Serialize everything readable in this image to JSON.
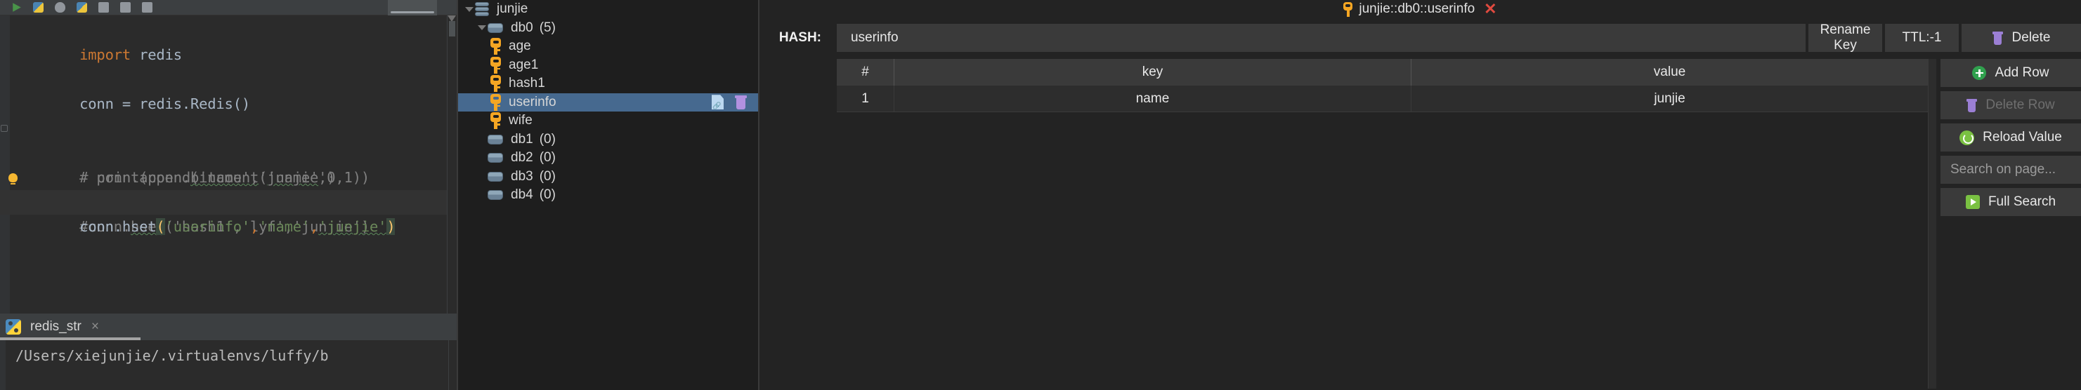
{
  "ide": {
    "toolbar_icons": [
      "run-icon",
      "python-config-icon",
      "debug-icon",
      "python-file-icon",
      "coverage-icon",
      "profile-icon",
      "stop-icon",
      "selected-tab"
    ],
    "code_lines": [
      {
        "id": "l1",
        "segments": [
          {
            "t": "import ",
            "c": "kw"
          },
          {
            "t": "redis",
            "c": "txt"
          }
        ]
      },
      {
        "id": "l2",
        "segments": []
      },
      {
        "id": "l3",
        "segments": [
          {
            "t": "conn = redis.Redis()",
            "c": "txt"
          }
        ]
      },
      {
        "id": "l4",
        "segments": []
      },
      {
        "id": "l5",
        "gutter": "fold",
        "segments": [
          {
            "t": "# print(conn.",
            "c": "cmt"
          },
          {
            "t": "bitcount",
            "c": "cmt squig"
          },
          {
            "t": "('name',0,1))",
            "c": "cmt"
          }
        ]
      },
      {
        "id": "l6",
        "segments": [
          {
            "t": "# conn.append('name','",
            "c": "cmt"
          },
          {
            "t": "junjie",
            "c": "cmt squig"
          },
          {
            "t": "')",
            "c": "cmt"
          }
        ]
      },
      {
        "id": "l7",
        "gutter": "bulb",
        "segments": [
          {
            "t": "#",
            "c": "cmt"
          },
          {
            "t": "conn.",
            "c": "cmt"
          },
          {
            "t": "hset",
            "c": "cmt squig"
          },
          {
            "t": "('hash1','lyf','junjie')",
            "c": "cmt"
          }
        ]
      },
      {
        "id": "l8",
        "highlight": true,
        "segments": [
          {
            "t": "conn.hset",
            "c": "txt"
          },
          {
            "t": "(",
            "c": "paren-hl"
          },
          {
            "t": "'userinfo'",
            "c": "str"
          },
          {
            "t": ",",
            "c": "kw"
          },
          {
            "t": "'name'",
            "c": "str"
          },
          {
            "t": ",",
            "c": "kw"
          },
          {
            "t": "'junjie'",
            "c": "str squig"
          },
          {
            "t": ")",
            "c": "paren-hl"
          }
        ]
      }
    ],
    "console": {
      "tab_label": "redis_str",
      "close_label": "×",
      "output": "/Users/xiejunjie/.virtualenvs/luffy/b"
    }
  },
  "tree": {
    "items": [
      {
        "id": "junjie",
        "label": "junjie",
        "count": "",
        "icon": "server-icon",
        "indent": 0,
        "expanded": true,
        "selected": false
      },
      {
        "id": "db0",
        "label": "db0",
        "count": "(5)",
        "icon": "database-icon",
        "indent": 1,
        "expanded": true,
        "selected": false
      },
      {
        "id": "age",
        "label": "age",
        "count": "",
        "icon": "key-icon",
        "indent": 2,
        "selected": false
      },
      {
        "id": "age1",
        "label": "age1",
        "count": "",
        "icon": "key-icon",
        "indent": 2,
        "selected": false
      },
      {
        "id": "hash1",
        "label": "hash1",
        "count": "",
        "icon": "key-icon",
        "indent": 2,
        "selected": false
      },
      {
        "id": "userinfo",
        "label": "userinfo",
        "count": "",
        "icon": "key-icon",
        "indent": 2,
        "selected": true
      },
      {
        "id": "wife",
        "label": "wife",
        "count": "",
        "icon": "key-icon",
        "indent": 2,
        "selected": false
      },
      {
        "id": "db1",
        "label": "db1",
        "count": "(0)",
        "icon": "database-icon",
        "indent": 1,
        "selected": false
      },
      {
        "id": "db2",
        "label": "db2",
        "count": "(0)",
        "icon": "database-icon",
        "indent": 1,
        "selected": false
      },
      {
        "id": "db3",
        "label": "db3",
        "count": "(0)",
        "icon": "database-icon",
        "indent": 1,
        "selected": false
      },
      {
        "id": "db4",
        "label": "db4",
        "count": "(0)",
        "icon": "database-icon",
        "indent": 1,
        "selected": false
      }
    ]
  },
  "value_panel": {
    "title": "junjie::db0::userinfo",
    "close_label": "✕",
    "type_label": "HASH:",
    "key_name": "userinfo",
    "buttons": {
      "rename": "Rename Key",
      "ttl": "TTL:-1",
      "delete": "Delete"
    },
    "table": {
      "headers": [
        "#",
        "key",
        "value"
      ],
      "rows": [
        {
          "num": "1",
          "key": "name",
          "value": "junjie"
        }
      ]
    },
    "actions": {
      "add_row": "Add Row",
      "delete_row": "Delete Row",
      "reload_value": "Reload Value",
      "search_placeholder": "Search on page...",
      "search_value": "",
      "full_search": "Full Search"
    }
  },
  "colors": {
    "selection_blue": "#46698f",
    "key_orange": "#f5a623",
    "green_accent": "#7ac142",
    "add_green": "#30a14e",
    "purple_trash": "#9b7fd4",
    "close_red": "#e04a3f",
    "panel_bg": "#232323",
    "tree_bg": "#1e1e1e",
    "ide_bg": "#2b2b2b"
  }
}
